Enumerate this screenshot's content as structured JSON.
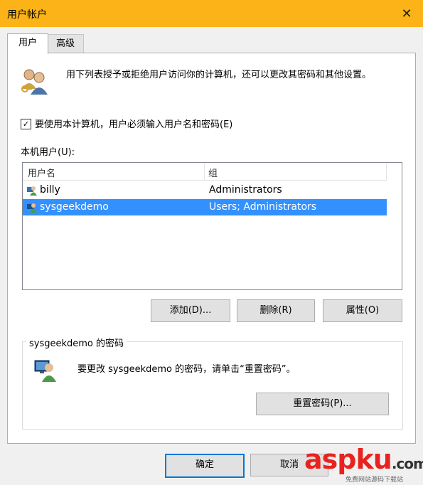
{
  "window": {
    "title": "用户帐户"
  },
  "tabs": [
    {
      "label": "用户"
    },
    {
      "label": "高级"
    }
  ],
  "intro": {
    "text": "用下列表授予或拒绝用户访问你的计算机，还可以更改其密码和其他设置。"
  },
  "require_password": {
    "checked": true,
    "check_mark": "✓",
    "label": "要使用本计算机，用户必须输入用户名和密码(E)"
  },
  "users": {
    "label": "本机用户(U):",
    "columns": [
      "用户名",
      "组"
    ],
    "rows": [
      {
        "name": "billy",
        "group": "Administrators",
        "selected": false
      },
      {
        "name": "sysgeekdemo",
        "group": "Users; Administrators",
        "selected": true
      }
    ]
  },
  "user_buttons": {
    "add": "添加(D)...",
    "remove": "删除(R)",
    "properties": "属性(O)"
  },
  "password_group": {
    "title": "sysgeekdemo 的密码",
    "text": "要更改 sysgeekdemo 的密码，请单击“重置密码”。",
    "reset_button": "重置密码(P)..."
  },
  "footer": {
    "ok": "确定",
    "cancel": "取消"
  },
  "watermark": {
    "brand": "aspku",
    "dot": ".",
    "suffix": "com",
    "tagline": "免费网站源码下载站"
  },
  "colors": {
    "titlebar": "#fbb317",
    "selection": "#3390ff",
    "default_button_border": "#0078d7",
    "watermark_red": "#e8231f"
  }
}
